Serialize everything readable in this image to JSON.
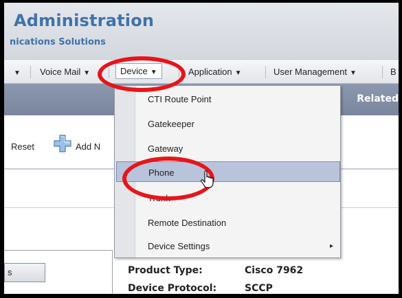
{
  "header": {
    "title": "Administration",
    "subtitle": "nications Solutions"
  },
  "menubar": {
    "items": [
      {
        "label": "Voice Mail"
      },
      {
        "label": "Device"
      },
      {
        "label": "Application"
      },
      {
        "label": "User Management"
      },
      {
        "label": "B"
      }
    ],
    "arrow": "▼"
  },
  "band": {
    "related": "Related"
  },
  "toolbar": {
    "reset_label": "Reset",
    "add_label": "Add N"
  },
  "dropdown": {
    "items": [
      {
        "label": "CTI Route Point"
      },
      {
        "label": "Gatekeeper"
      },
      {
        "label": "Gateway"
      },
      {
        "label": "Phone",
        "highlighted": true
      },
      {
        "label": "Trunk"
      },
      {
        "label": "Remote Destination"
      },
      {
        "label": "Device Settings",
        "has_submenu": true
      }
    ],
    "submenu_arrow": "▸"
  },
  "details": {
    "left_button": "s",
    "product_type_label": "Product Type:",
    "product_type_value": "Cisco 7962",
    "protocol_label": "Device Protocol:",
    "protocol_value": "SCCP"
  },
  "icons": {
    "add": "add-icon",
    "cursor": "hand-pointer-icon"
  },
  "colors": {
    "title": "#3f73a8",
    "band": "#7a869d",
    "highlight": "#b9c3db",
    "annotation": "#e8141a"
  }
}
